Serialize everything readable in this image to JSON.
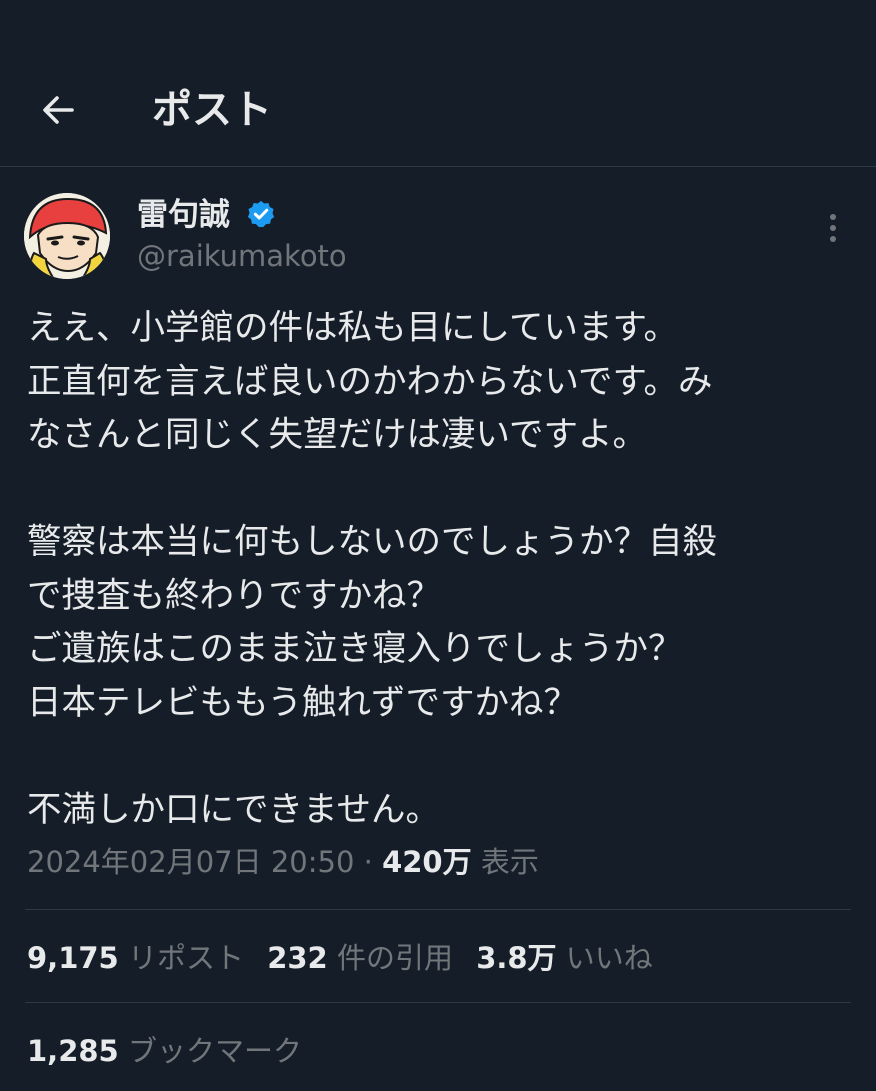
{
  "header": {
    "back_icon": "arrow-left-icon",
    "title": "ポスト"
  },
  "author": {
    "display_name": "雷句誠",
    "handle": "@raikumakoto",
    "verified_icon": "verified-badge-icon",
    "verified_color": "#1d9bf0"
  },
  "more_icon": "more-vertical-icon",
  "tweet": {
    "lines": [
      "ええ、小学館の件は私も目にしています。",
      "正直何を言えば良いのかわからないです。み",
      "なさんと同じく失望だけは凄いですよ。",
      "",
      "警察は本当に何もしないのでしょうか？自殺",
      "で捜査も終わりですかね？",
      "ご遺族はこのまま泣き寝入りでしょうか？",
      "日本テレビももう触れずですかね？",
      "",
      "不満しか口にできません。"
    ]
  },
  "meta": {
    "datetime": "2024年02月07日 20:50",
    "separator": "·",
    "views": "420万",
    "views_label": "表示"
  },
  "stats": {
    "reposts": "9,175",
    "reposts_label": "リポスト",
    "quotes": "232",
    "quotes_label": "件の引用",
    "likes": "3.8万",
    "likes_label": "いいね",
    "bookmarks": "1,285",
    "bookmarks_label": "ブックマーク"
  },
  "colors": {
    "background": "#151d28",
    "text_primary": "#e7e9ea",
    "text_secondary": "#71767b",
    "divider": "#2f3944"
  }
}
